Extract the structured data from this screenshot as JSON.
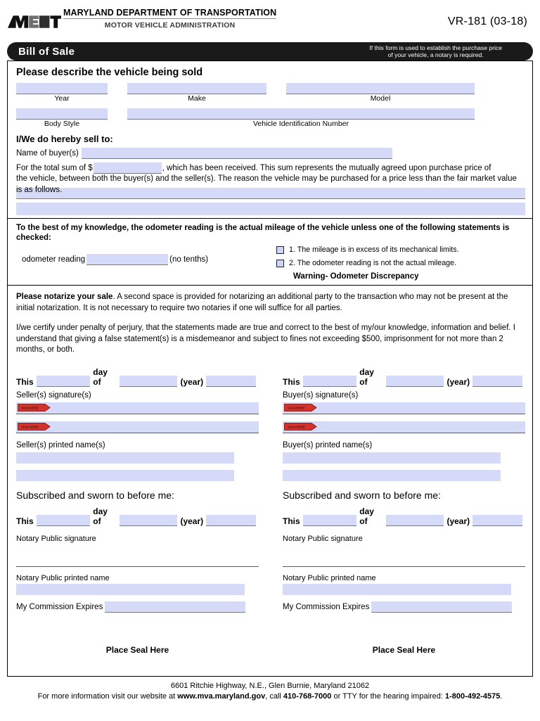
{
  "header": {
    "agency_name": "MARYLAND DEPARTMENT OF TRANSPORTATION",
    "agency_sub": "MOTOR VEHICLE ADMINISTRATION",
    "form_number": "VR-181 (03-18)",
    "title": "Bill of Sale",
    "note_line1": "If this form is used to establish the purchase price",
    "note_line2": "of your vehicle, a notary is required."
  },
  "vehicle": {
    "heading": "Please describe the vehicle being sold",
    "year_label": "Year",
    "make_label": "Make",
    "model_label": "Model",
    "body_style_label": "Body Style",
    "vin_label": "Vehicle Identification Number",
    "year_value": "",
    "make_value": "",
    "model_value": "",
    "body_style_value": "",
    "vin_value": ""
  },
  "sell_to": {
    "heading": "I/We do hereby sell to:",
    "buyer_name_label": "Name of buyer(s)",
    "buyer_name_value": "",
    "sum_prefix": "For the total sum of $",
    "sum_value": "",
    "sum_suffix": ", which has been received. This sum represents the mutually agreed upon purchase price of",
    "line2": "the vehicle, between both the buyer(s) and the seller(s).  The reason the vehicle may be purchased for a price less than the fair market value",
    "line3": "is as follows.",
    "reason_line1": "",
    "reason_line2": ""
  },
  "odometer": {
    "statement": "To the best of my knowledge, the odometer reading is the actual mileage of the vehicle unless one of the following statements is checked:",
    "reading_label": "odometer reading",
    "reading_value": "",
    "no_tenths": "(no tenths)",
    "checkbox1": "1. The mileage is in excess of its mechanical limits.",
    "checkbox2": "2. The odometer reading is not the actual mileage.",
    "checkbox1_checked": false,
    "checkbox2_checked": false,
    "warning": "Warning- Odometer Discrepancy"
  },
  "notarize": {
    "bold_lead": "Please notarize your sale",
    "intro": ". A second space is provided for notarizing an additional party to the transaction who may not be present at the initial notarization. It is not necessary to require two notaries if one will suffice for all parties.",
    "certify": "I/we certify under penalty of perjury, that the statements made are true and correct to the best of my/our knowledge, information and belief. I understand that giving a false statement(s) is a misdemeanor and subject to fines not exceeding $500, imprisonment for not more than 2 months, or both."
  },
  "date_row": {
    "this_label": "This",
    "day_of_label": "day of",
    "year_label": "(year)",
    "day_value": "",
    "month_value": "",
    "year_value": ""
  },
  "seller_column": {
    "signature_label": "Seller(s) signature(s)",
    "printed_name_label": "Seller(s) printed name(s)",
    "signature1_value": "",
    "signature2_value": "",
    "printed1_value": "",
    "printed2_value": "",
    "sign_tag": "Sign Here"
  },
  "buyer_column": {
    "signature_label": "Buyer(s) signature(s)",
    "printed_name_label": "Buyer(s) printed name(s)",
    "signature1_value": "",
    "signature2_value": "",
    "printed1_value": "",
    "printed2_value": "",
    "sign_tag": "Sign Here"
  },
  "notary": {
    "sworn_label": "Subscribed and sworn to before me:",
    "signature_label": "Notary Public signature",
    "printed_name_label": "Notary Public printed name",
    "commission_label": "My Commission Expires",
    "printed_name_value": "",
    "commission_value": "",
    "day_value": "",
    "month_value": "",
    "year_value": "",
    "seal_label": "Place Seal Here"
  },
  "footer": {
    "address": "6601 Ritchie Highway, N.E., Glen Burnie, Maryland 21062",
    "info_pre": "For more information visit our website at ",
    "website": "www.mva.maryland.gov",
    "info_mid": ", call ",
    "phone": "410-768-7000",
    "info_mid2": " or TTY for the hearing impaired: ",
    "tty": "1-800-492-4575",
    "info_end": "."
  },
  "colors": {
    "field_fill": "#d4daf7",
    "header_bar": "#1a1a1a",
    "sign_tag": "#d0342c",
    "checkbox_border": "#17203f"
  }
}
